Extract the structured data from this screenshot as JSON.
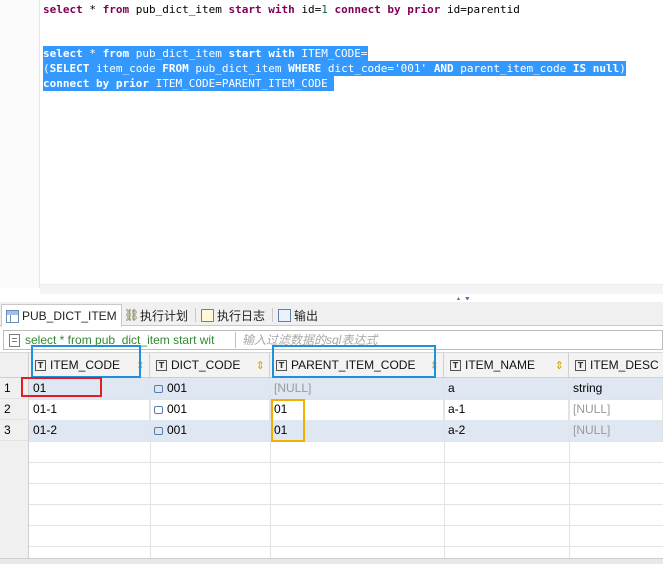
{
  "editor": {
    "line1": {
      "a": "select",
      "b": " * ",
      "c": "from",
      "d": " pub_dict_item ",
      "e": "start with",
      "f": " id=",
      "g": "1",
      "h": " ",
      "i": "connect by prior",
      "j": " id=parentid"
    },
    "line2": {
      "a": "select",
      "b": " * ",
      "c": "from",
      "d": " pub_dict_item ",
      "e": "start with",
      "f": " ITEM_CODE="
    },
    "line3": {
      "a": "(",
      "b": "SELECT",
      "c": " item_code ",
      "d": "FROM",
      "e": " pub_dict_item ",
      "f": "WHERE",
      "g": " dict_code=",
      "h": "'001'",
      "i": " ",
      "j": "AND",
      "k": " parent_item_code ",
      "l": "IS null",
      "m": ")"
    },
    "line4": {
      "a": "connect by prior",
      "b": " ITEM_CODE=PARENT_ITEM_CODE "
    }
  },
  "tabs": [
    {
      "label": "PUB_DICT_ITEM",
      "icon": "table-icon",
      "active": true
    },
    {
      "label": "执行计划",
      "icon": "plan-icon",
      "active": false
    },
    {
      "label": "执行日志",
      "icon": "log-icon",
      "active": false
    },
    {
      "label": "输出",
      "icon": "output-icon",
      "active": false
    }
  ],
  "filter": {
    "sql": "select * from pub_dict_item start wit",
    "placeholder": "输入过滤数据的sql表达式"
  },
  "grid": {
    "columns": [
      "ITEM_CODE",
      "DICT_CODE",
      "PARENT_ITEM_CODE",
      "ITEM_NAME",
      "ITEM_DESC"
    ],
    "rows": [
      {
        "num": "1",
        "cells": [
          "01",
          "001",
          "[NULL]",
          "a",
          "string"
        ]
      },
      {
        "num": "2",
        "cells": [
          "01-1",
          "001",
          "01",
          "a-1",
          "[NULL]"
        ]
      },
      {
        "num": "3",
        "cells": [
          "01-2",
          "001",
          "01",
          "a-2",
          "[NULL]"
        ]
      }
    ]
  },
  "colors": {
    "selection": "#3399ff",
    "annotation_blue": "#1e90e0",
    "annotation_red": "#e02020",
    "annotation_orange": "#f0b000"
  }
}
